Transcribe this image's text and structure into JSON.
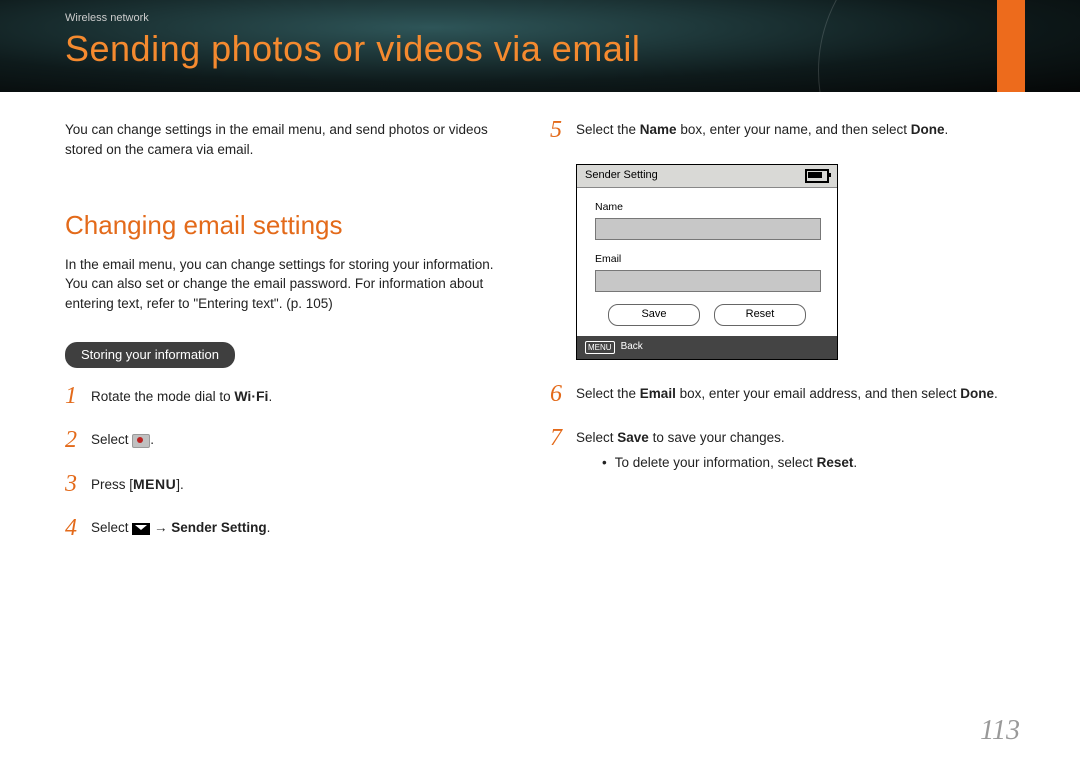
{
  "header": {
    "breadcrumb": "Wireless network",
    "title": "Sending photos or videos via email"
  },
  "intro": "You can change settings in the email menu, and send photos or videos stored on the camera via email.",
  "section": {
    "heading": "Changing email settings",
    "text": "In the email menu, you can change settings for storing your information. You can also set or change the email password. For information about entering text, refer to \"Entering text\". (p. 105)",
    "pill": "Storing your information"
  },
  "steps_left": {
    "s1": {
      "num": "1",
      "a": "Rotate the mode dial to ",
      "wifi": "Wi·Fi",
      "b": "."
    },
    "s2": {
      "num": "2",
      "a": "Select ",
      "b": "."
    },
    "s3": {
      "num": "3",
      "a": "Press [",
      "menu": "MENU",
      "b": "]."
    },
    "s4": {
      "num": "4",
      "a": "Select ",
      "arrow": " → ",
      "target": "Sender Setting",
      "b": "."
    }
  },
  "steps_right": {
    "s5": {
      "num": "5",
      "a": "Select the ",
      "name": "Name",
      "b": " box, enter your name, and then select ",
      "done": "Done",
      "c": "."
    },
    "s6": {
      "num": "6",
      "a": "Select the ",
      "email": "Email",
      "b": " box, enter your email address, and then select ",
      "done": "Done",
      "c": "."
    },
    "s7": {
      "num": "7",
      "a": "Select ",
      "save": "Save",
      "b": " to save your changes."
    },
    "bullet": {
      "a": "To delete your information, select ",
      "reset": "Reset",
      "b": "."
    }
  },
  "screenshot": {
    "title": "Sender Setting",
    "name_label": "Name",
    "email_label": "Email",
    "save": "Save",
    "reset": "Reset",
    "menu_chip": "MENU",
    "back": "Back"
  },
  "page_number": "113"
}
